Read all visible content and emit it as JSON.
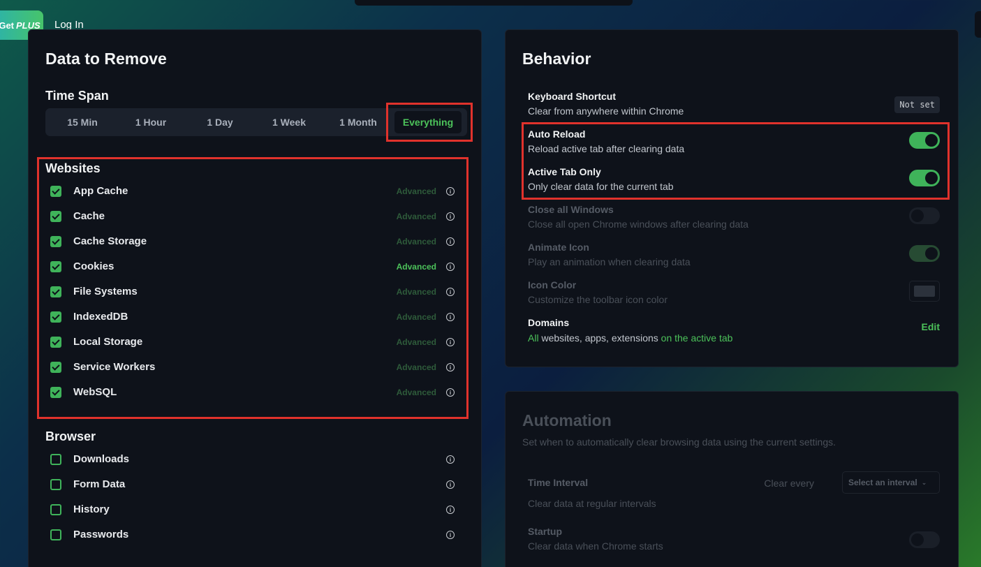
{
  "header": {
    "get_plus_prefix": "Get",
    "get_plus_emph": "PLUS",
    "login": "Log In"
  },
  "data_to_remove": {
    "title": "Data to Remove",
    "time_span": {
      "label": "Time Span",
      "options": [
        "15 Min",
        "1 Hour",
        "1 Day",
        "1 Week",
        "1 Month",
        "Everything"
      ],
      "selected": "Everything"
    },
    "websites": {
      "title": "Websites",
      "items": [
        {
          "label": "App Cache",
          "checked": true,
          "advanced": "Advanced"
        },
        {
          "label": "Cache",
          "checked": true,
          "advanced": "Advanced"
        },
        {
          "label": "Cache Storage",
          "checked": true,
          "advanced": "Advanced"
        },
        {
          "label": "Cookies",
          "checked": true,
          "advanced": "Advanced"
        },
        {
          "label": "File Systems",
          "checked": true,
          "advanced": "Advanced"
        },
        {
          "label": "IndexedDB",
          "checked": true,
          "advanced": "Advanced"
        },
        {
          "label": "Local Storage",
          "checked": true,
          "advanced": "Advanced"
        },
        {
          "label": "Service Workers",
          "checked": true,
          "advanced": "Advanced"
        },
        {
          "label": "WebSQL",
          "checked": true,
          "advanced": "Advanced"
        }
      ]
    },
    "browser": {
      "title": "Browser",
      "items": [
        {
          "label": "Downloads",
          "checked": false
        },
        {
          "label": "Form Data",
          "checked": false
        },
        {
          "label": "History",
          "checked": false
        },
        {
          "label": "Passwords",
          "checked": false
        }
      ]
    }
  },
  "behavior": {
    "title": "Behavior",
    "keyboard_shortcut": {
      "title": "Keyboard Shortcut",
      "desc": "Clear from anywhere within Chrome",
      "value": "Not set"
    },
    "auto_reload": {
      "title": "Auto Reload",
      "desc": "Reload active tab after clearing data",
      "on": true
    },
    "active_tab_only": {
      "title": "Active Tab Only",
      "desc": "Only clear data for the current tab",
      "on": true
    },
    "close_all_windows": {
      "title": "Close all Windows",
      "desc": "Close all open Chrome windows after clearing data",
      "on": false
    },
    "animate_icon": {
      "title": "Animate Icon",
      "desc": "Play an animation when clearing data",
      "on": true
    },
    "icon_color": {
      "title": "Icon Color",
      "desc": "Customize the toolbar icon color",
      "color": "#2c323c"
    },
    "domains": {
      "title": "Domains",
      "all": "All",
      "middle": " websites, apps, extensions ",
      "scope": "on the active tab",
      "edit": "Edit"
    }
  },
  "automation": {
    "title": "Automation",
    "subtitle": "Set when to automatically clear browsing data using the current settings.",
    "time_interval": {
      "title": "Time Interval",
      "desc": "Clear data at regular intervals",
      "clear_every": "Clear every",
      "select_placeholder": "Select an interval"
    },
    "startup": {
      "title": "Startup",
      "desc": "Clear data when Chrome starts",
      "on": false
    }
  },
  "colors": {
    "accent": "#4cc25a",
    "highlight": "#e0322c",
    "panel": "#0e121a"
  }
}
